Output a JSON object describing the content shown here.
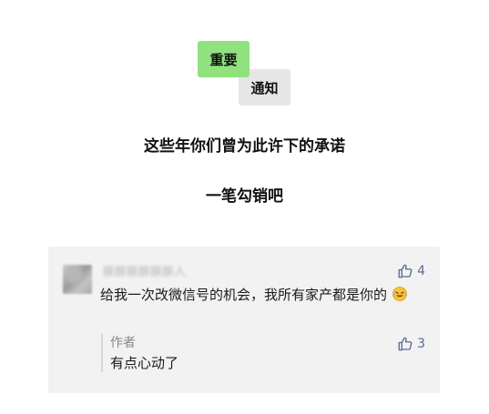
{
  "tags": {
    "important": "重要",
    "notice": "通知"
  },
  "headline": {
    "line1": "这些年你们曾为此许下的承诺",
    "line2": "一笔勾销吧"
  },
  "comment": {
    "nickname": "豚豚豚豚豚豚人",
    "likes": "4",
    "text": "给我一次改微信号的机会，我所有家产都是你的",
    "emoji": "crying-laughing-emoji",
    "reply": {
      "author": "作者",
      "likes": "3",
      "text": "有点心动了"
    }
  },
  "colors": {
    "tag_green": "#8fe27e",
    "tag_gray": "#e6e6e6",
    "like_blue": "#576b95",
    "comment_bg": "#f2f2f2"
  }
}
